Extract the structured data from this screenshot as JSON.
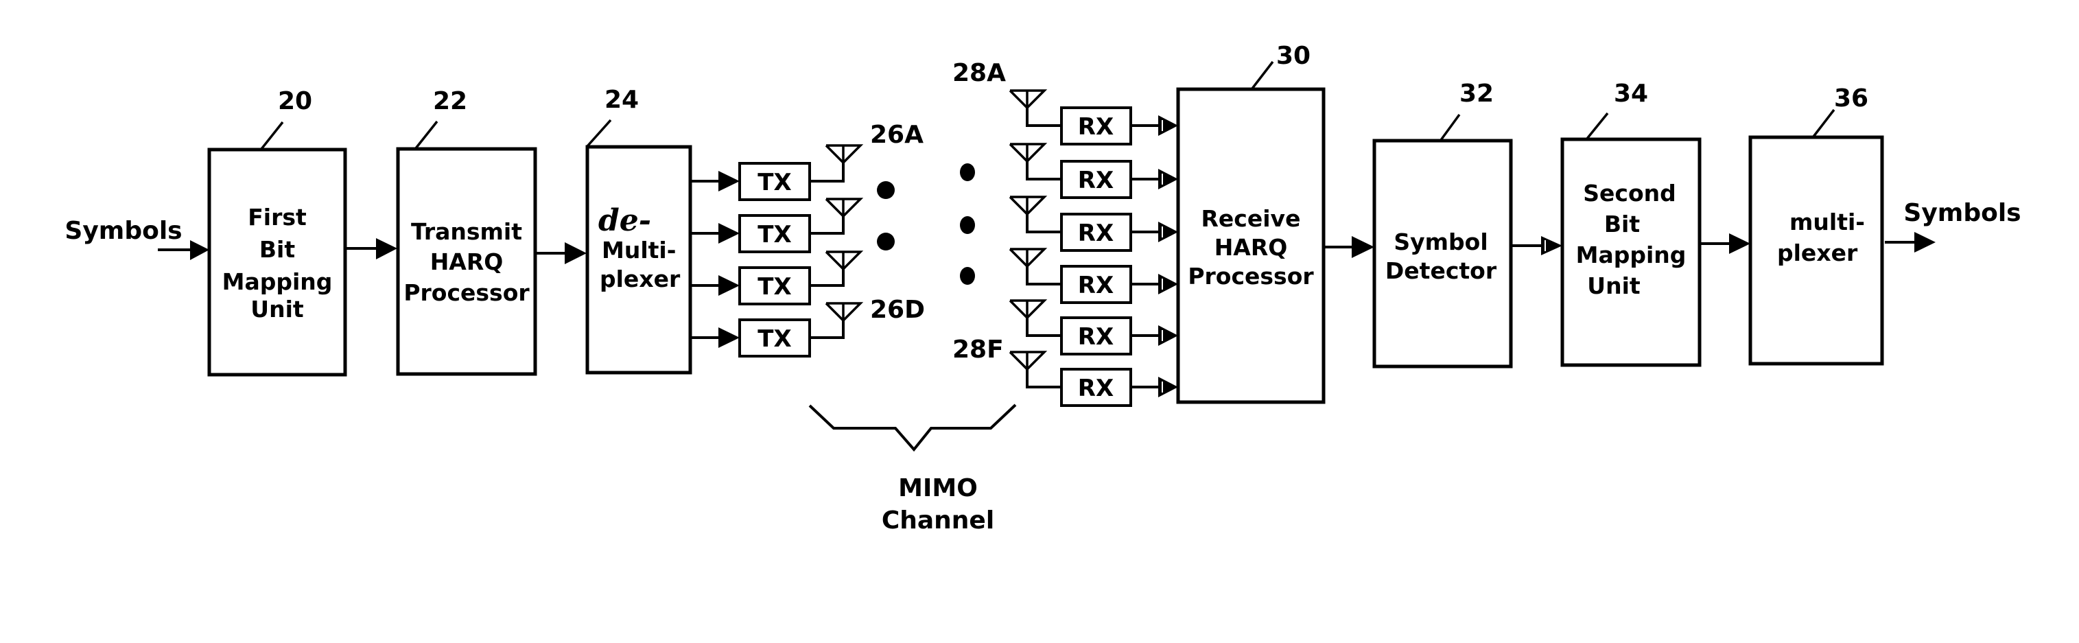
{
  "figure": {
    "input_label": "Symbols",
    "output_label": "Symbols",
    "channel_label_line1": "MIMO",
    "channel_label_line2": "Channel",
    "blocks": {
      "first_bit_mapping": {
        "ref": "20",
        "lines": [
          "First",
          "Bit",
          "Mapping",
          "Unit"
        ]
      },
      "transmit_harq": {
        "ref": "22",
        "lines": [
          "Transmit",
          "HARQ",
          "Processor"
        ]
      },
      "demultiplexer": {
        "ref": "24",
        "annotation": "de-",
        "lines": [
          "Multi-",
          "plexer"
        ]
      },
      "receive_harq": {
        "ref": "30",
        "lines": [
          "Receive",
          "HARQ",
          "Processor"
        ]
      },
      "symbol_detector": {
        "ref": "32",
        "lines": [
          "Symbol",
          "Detector"
        ]
      },
      "second_bit_mapping": {
        "ref": "34",
        "lines": [
          "Second",
          "Bit",
          "Mapping",
          "Unit"
        ]
      },
      "multiplexer": {
        "ref": "36",
        "lines": [
          "multi-",
          "plexer"
        ]
      }
    },
    "transmitters": {
      "label": "TX",
      "count": 4,
      "antenna_first_ref": "26A",
      "antenna_last_ref": "26D"
    },
    "receivers": {
      "label": "RX",
      "count": 6,
      "antenna_first_ref": "28A",
      "antenna_last_ref": "28F"
    }
  }
}
